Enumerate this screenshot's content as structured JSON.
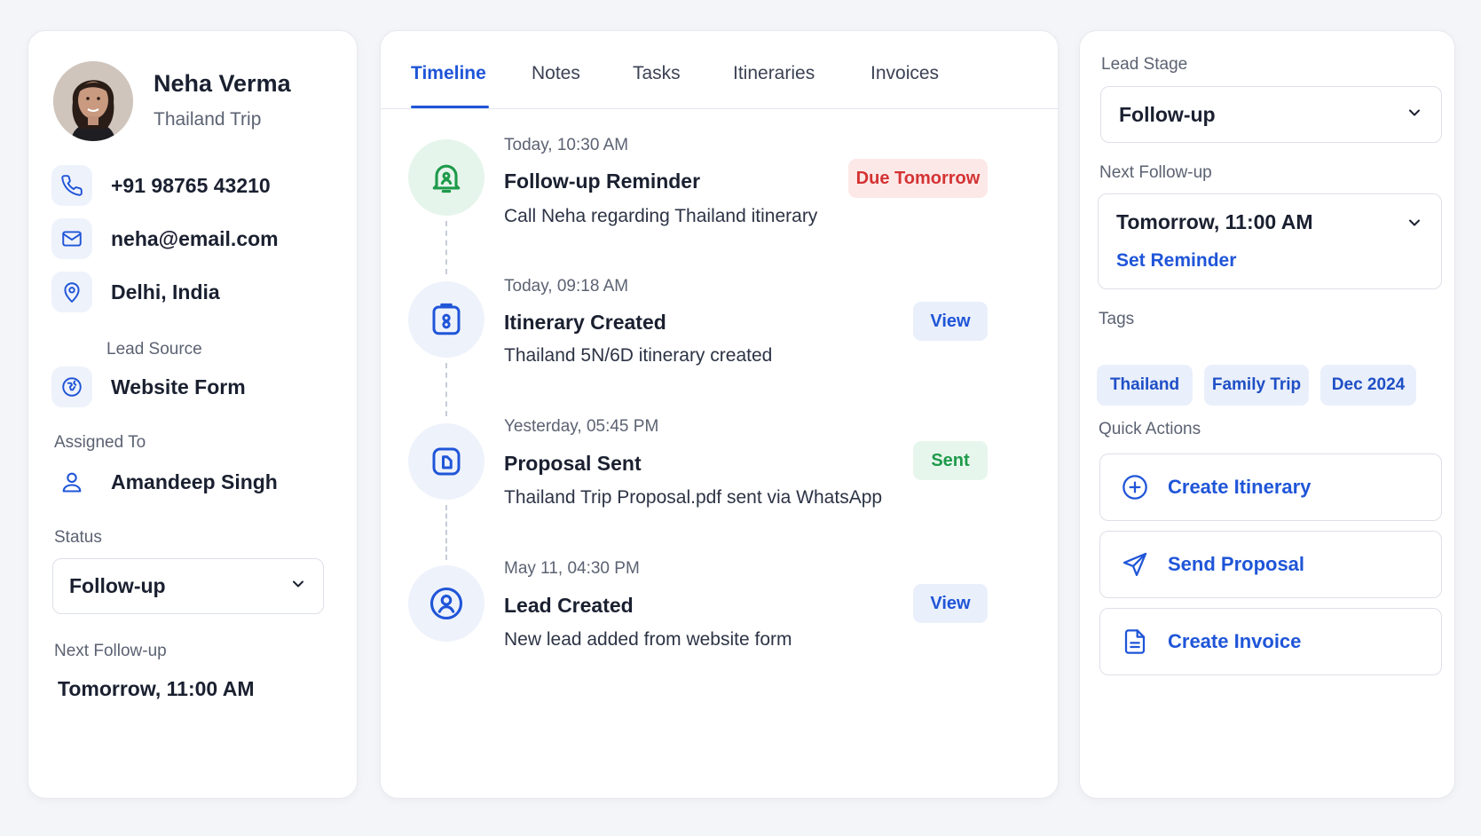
{
  "colors": {
    "accent_blue": "#1f55d8",
    "green_badge_bg": "#e7f6ec",
    "green_text": "#1e9a4b",
    "red_badge_bg": "#fde8e8",
    "red_text": "#d43333",
    "view_bg": "#e9effb"
  },
  "profile": {
    "name": "Neha Verma",
    "trip": "Thailand Trip",
    "phone": "+91 98765 43210",
    "email": "neha@email.com",
    "location": "Delhi, India",
    "lead_source_label": "Lead Source",
    "lead_source": "Website Form",
    "assigned_to_label": "Assigned To",
    "assigned_to": "Amandeep Singh",
    "status_label": "Status",
    "status_value": "Follow-up",
    "next_followup_label": "Next Follow-up",
    "next_followup_value": "Tomorrow, 11:00 AM"
  },
  "tabs": [
    {
      "label": "Timeline",
      "active": true
    },
    {
      "label": "Notes",
      "active": false
    },
    {
      "label": "Tasks",
      "active": false
    },
    {
      "label": "Itineraries",
      "active": false
    },
    {
      "label": "Invoices",
      "active": false
    }
  ],
  "timeline": [
    {
      "time": "Today, 10:30 AM",
      "title": "Follow-up Reminder",
      "desc": "Call Neha regarding Thailand itinerary",
      "badge": "Due Tomorrow",
      "icon": "bell-icon"
    },
    {
      "time": "Today, 09:18 AM",
      "title": "Itinerary Created",
      "desc": "Thailand 5N/6D itinerary created",
      "badge": "View",
      "icon": "itinerary-icon"
    },
    {
      "time": "Yesterday, 05:45 PM",
      "title": "Proposal Sent",
      "desc": "Thailand Trip Proposal.pdf sent via WhatsApp",
      "badge": "Sent",
      "icon": "document-icon"
    },
    {
      "time": "May 11, 04:30 PM",
      "title": "Lead Created",
      "desc": "New lead added from website form",
      "badge": "View",
      "icon": "user-circle-icon"
    }
  ],
  "side": {
    "lead_stage_label": "Lead Stage",
    "lead_stage_value": "Follow-up",
    "next_followup_label": "Next Follow-up",
    "next_followup_value": "Tomorrow, 11:00 AM",
    "set_reminder": "Set Reminder",
    "tags_label": "Tags",
    "tags": [
      "Thailand",
      "Family Trip",
      "Dec 2024"
    ],
    "quick_actions_label": "Quick Actions",
    "actions": [
      {
        "label": "Create Itinerary",
        "icon": "plus-circle-icon"
      },
      {
        "label": "Send Proposal",
        "icon": "send-icon"
      },
      {
        "label": "Create Invoice",
        "icon": "invoice-icon"
      }
    ]
  }
}
